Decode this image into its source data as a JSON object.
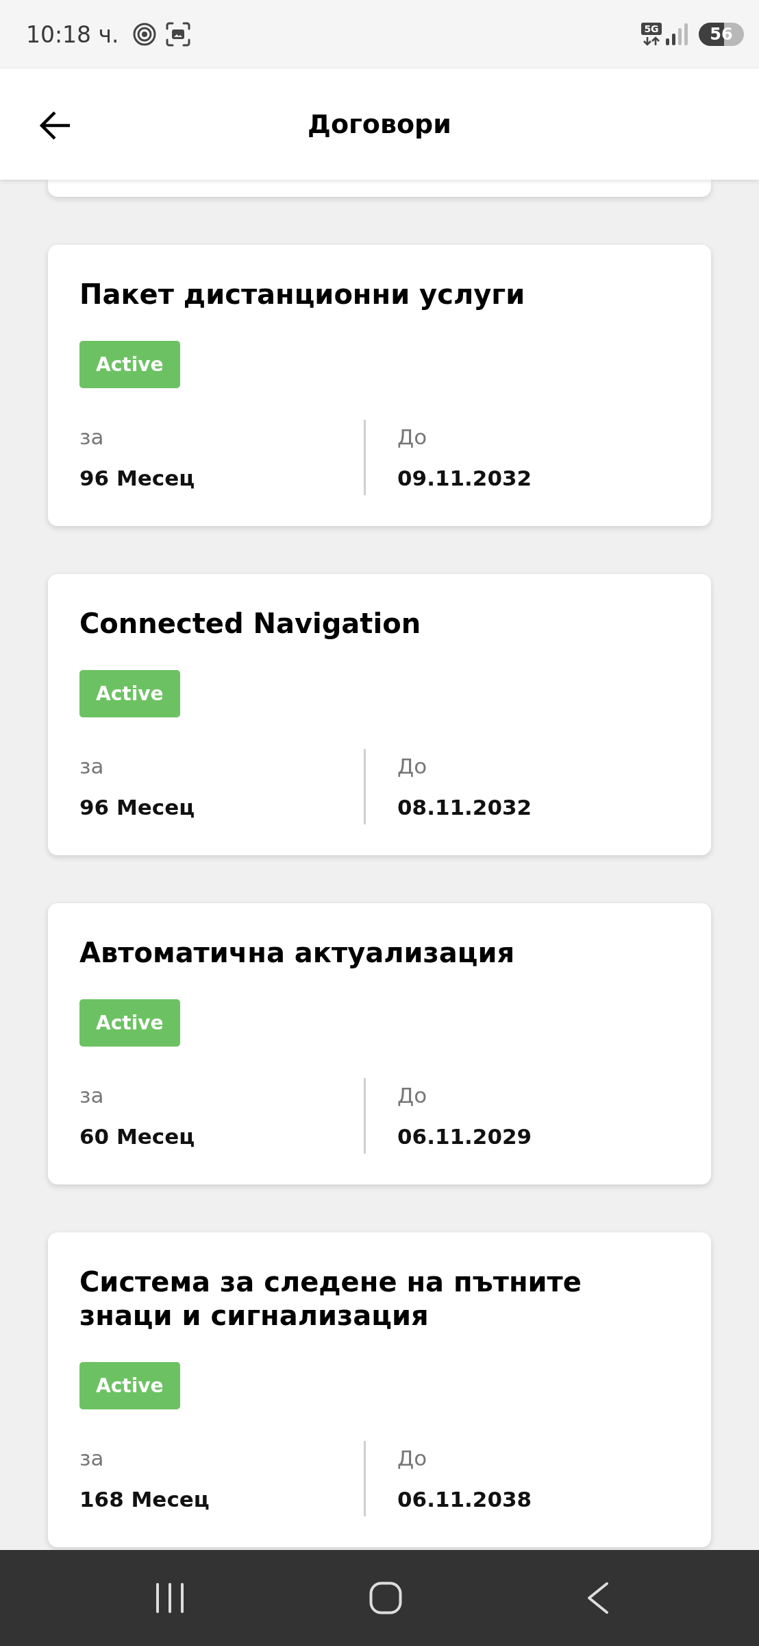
{
  "status_bar": {
    "time": "10:18 ч.",
    "network": "5G",
    "battery": "56"
  },
  "header": {
    "title": "Договори"
  },
  "contracts": [
    {
      "title": "Пакет дистанционни услуги",
      "status": "Active",
      "term_label": "за",
      "term": "96 Месец",
      "end_label": "До",
      "end_date": "09.11.2032"
    },
    {
      "title": "Connected Navigation",
      "status": "Active",
      "term_label": "за",
      "term": "96 Месец",
      "end_label": "До",
      "end_date": "08.11.2032"
    },
    {
      "title": "Автоматична актуализация",
      "status": "Active",
      "term_label": "за",
      "term": "60 Месец",
      "end_label": "До",
      "end_date": "06.11.2029"
    },
    {
      "title": "Система за следене на пътните знаци и сигнализация",
      "status": "Active",
      "term_label": "за",
      "term": "168 Месец",
      "end_label": "До",
      "end_date": "06.11.2038"
    }
  ]
}
